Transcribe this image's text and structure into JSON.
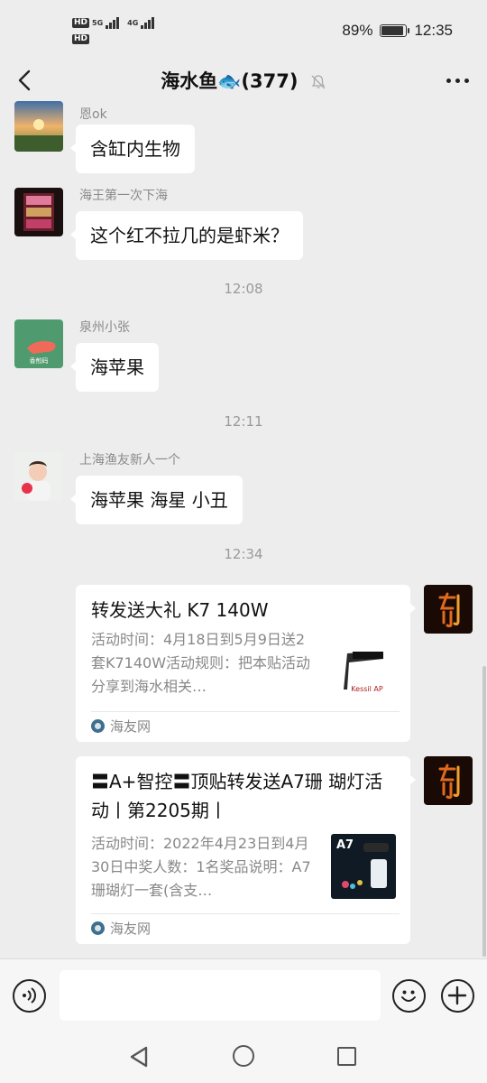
{
  "status_bar": {
    "network_1": "5G",
    "network_2": "4G",
    "hd_1": "HD",
    "hd_2": "HD",
    "battery_percent": "89%",
    "battery_level": 0.89,
    "time": "12:35"
  },
  "header": {
    "title": "海水鱼🐟(377)",
    "back_icon": "chevron-left-icon",
    "mute_icon": "bell-off-icon",
    "more_icon": "more-dots-icon"
  },
  "messages": [
    {
      "sender": "恩ok",
      "text": "含缸内生物"
    },
    {
      "sender": "海王第一次下海",
      "text": "这个红不拉几的是虾米？"
    },
    {
      "sender": "泉州小张",
      "text": "海苹果",
      "avatar_caption": "香煎码"
    },
    {
      "sender": "上海渔友新人一个",
      "text": "海苹果 海星 小丑"
    }
  ],
  "timestamps": [
    "12:08",
    "12:11",
    "12:34"
  ],
  "cards": [
    {
      "title": "转发送大礼 K7 140W",
      "desc": "活动时间：4月18日到5月9日送2套K7140W活动规则：把本贴活动分享到海水相关…",
      "thumb_caption": "Kessil AP",
      "source": "海友网"
    },
    {
      "title": "〓A+智控〓顶贴转发送A7珊 瑚灯活动丨第2205期丨",
      "desc": "活动时间：2022年4月23日到4月30日中奖人数：1名奖品说明：A7珊瑚灯一套(含支…",
      "thumb_caption": "A7",
      "source": "海友网"
    }
  ],
  "input_bar": {
    "voice_icon": "voice-icon",
    "emoji_icon": "emoji-icon",
    "plus_icon": "plus-icon",
    "placeholder": ""
  },
  "nav_bar": {
    "back_icon": "triangle-back-icon",
    "home_icon": "circle-home-icon",
    "recent_icon": "square-recent-icon"
  }
}
